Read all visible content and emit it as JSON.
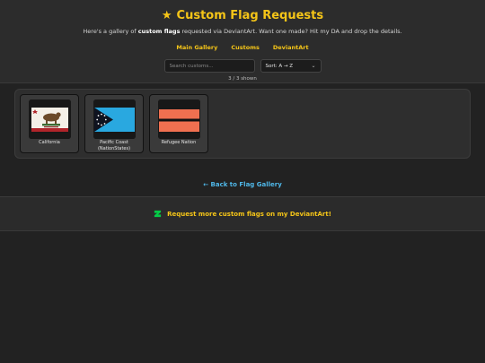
{
  "header": {
    "title_icon": "star-icon",
    "title": "Custom Flag Requests",
    "subtitle_pre": "Here's a gallery of ",
    "subtitle_bold": "custom flags",
    "subtitle_post": " requested via DeviantArt. Want one made? Hit my DA and drop the details."
  },
  "nav": [
    {
      "label": "Main Gallery"
    },
    {
      "label": "Customs"
    },
    {
      "label": "DeviantArt"
    }
  ],
  "search": {
    "value": "",
    "placeholder": "Search customs..."
  },
  "sort": {
    "selected": "Sort: A → Z"
  },
  "count_text": "3 / 3 shown",
  "flags": [
    {
      "name": "California",
      "image": "california-flag"
    },
    {
      "name": "Pacific Coast",
      "name_line2": "(NationStates)",
      "image": "pacific-coast-flag"
    },
    {
      "name": "Refugee Nation",
      "image": "refugee-nation-flag"
    }
  ],
  "back_link": "← Back to Flag Gallery",
  "footer": {
    "icon": "deviantart-icon",
    "link": "Request more custom flags on my DeviantArt!"
  },
  "colors": {
    "accent": "#f5c518",
    "link": "#4fb7e8",
    "background": "#222222"
  }
}
